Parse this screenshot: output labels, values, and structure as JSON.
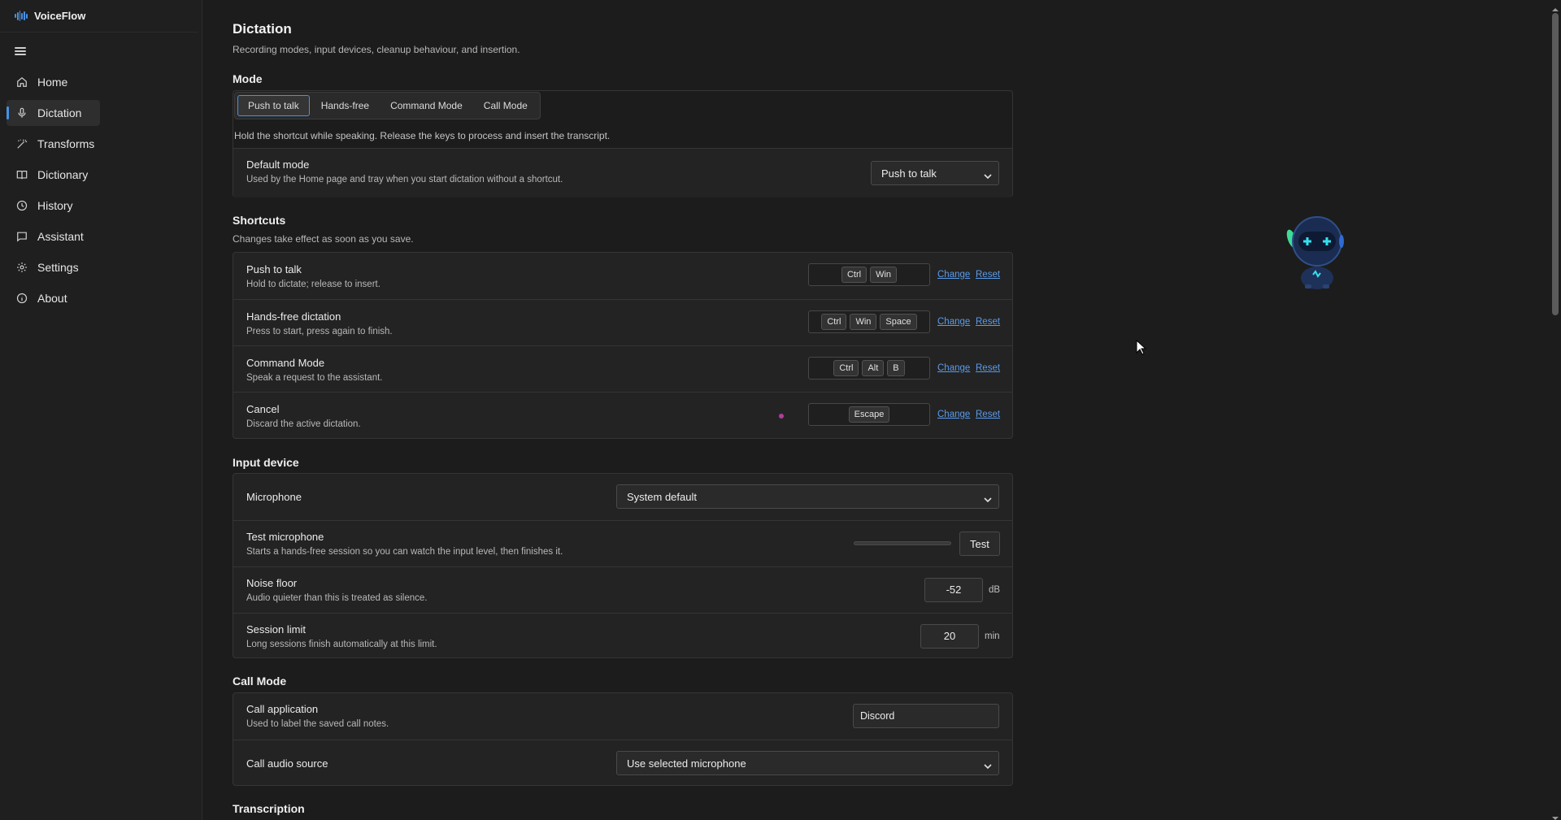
{
  "app": {
    "name": "VoiceFlow"
  },
  "sidebar": {
    "items": [
      {
        "label": "Home",
        "icon": "home-icon"
      },
      {
        "label": "Dictation",
        "icon": "microphone-icon",
        "active": true
      },
      {
        "label": "Transforms",
        "icon": "magic-wand-icon"
      },
      {
        "label": "Dictionary",
        "icon": "book-icon"
      },
      {
        "label": "History",
        "icon": "clock-icon"
      },
      {
        "label": "Assistant",
        "icon": "chat-icon"
      },
      {
        "label": "Settings",
        "icon": "gear-icon"
      },
      {
        "label": "About",
        "icon": "info-icon"
      }
    ]
  },
  "page": {
    "title": "Dictation",
    "subtitle": "Recording modes, input devices, cleanup behaviour, and insertion."
  },
  "mode": {
    "title": "Mode",
    "tabs": [
      "Push to talk",
      "Hands-free",
      "Command Mode",
      "Call Mode"
    ],
    "active_tab": "Push to talk",
    "hint": "Hold the shortcut while speaking. Release the keys to process and insert the transcript.",
    "default_mode": {
      "title": "Default mode",
      "desc": "Used by the Home page and tray when you start dictation without a shortcut.",
      "value": "Push to talk"
    }
  },
  "shortcuts": {
    "title": "Shortcuts",
    "subtitle": "Changes take effect as soon as you save.",
    "change_label": "Change",
    "reset_label": "Reset",
    "items": [
      {
        "title": "Push to talk",
        "desc": "Hold to dictate; release to insert.",
        "keys": [
          "Ctrl",
          "Win"
        ]
      },
      {
        "title": "Hands-free dictation",
        "desc": "Press to start, press again to finish.",
        "keys": [
          "Ctrl",
          "Win",
          "Space"
        ]
      },
      {
        "title": "Command Mode",
        "desc": "Speak a request to the assistant.",
        "keys": [
          "Ctrl",
          "Alt",
          "B"
        ]
      },
      {
        "title": "Cancel",
        "desc": "Discard the active dictation.",
        "keys": [
          "Escape"
        ]
      }
    ]
  },
  "input_device": {
    "title": "Input device",
    "microphone": {
      "title": "Microphone",
      "value": "System default"
    },
    "test": {
      "title": "Test microphone",
      "desc": "Starts a hands-free session so you can watch the input level, then finishes it.",
      "button": "Test",
      "level": 0
    },
    "noise_floor": {
      "title": "Noise floor",
      "desc": "Audio quieter than this is treated as silence.",
      "value": "-52",
      "unit": "dB"
    },
    "session_limit": {
      "title": "Session limit",
      "desc": "Long sessions finish automatically at this limit.",
      "value": "20",
      "unit": "min"
    }
  },
  "call_mode": {
    "title": "Call Mode",
    "application": {
      "title": "Call application",
      "desc": "Used to label the saved call notes.",
      "value": "Discord"
    },
    "audio_source": {
      "title": "Call audio source",
      "value": "Use selected microphone"
    }
  },
  "transcription": {
    "title": "Transcription"
  },
  "colors": {
    "accent": "#4a90e2",
    "background": "#1c1c1c",
    "card": "#232323",
    "link": "#5a9bea",
    "recording_dot": "#b03d9b"
  }
}
